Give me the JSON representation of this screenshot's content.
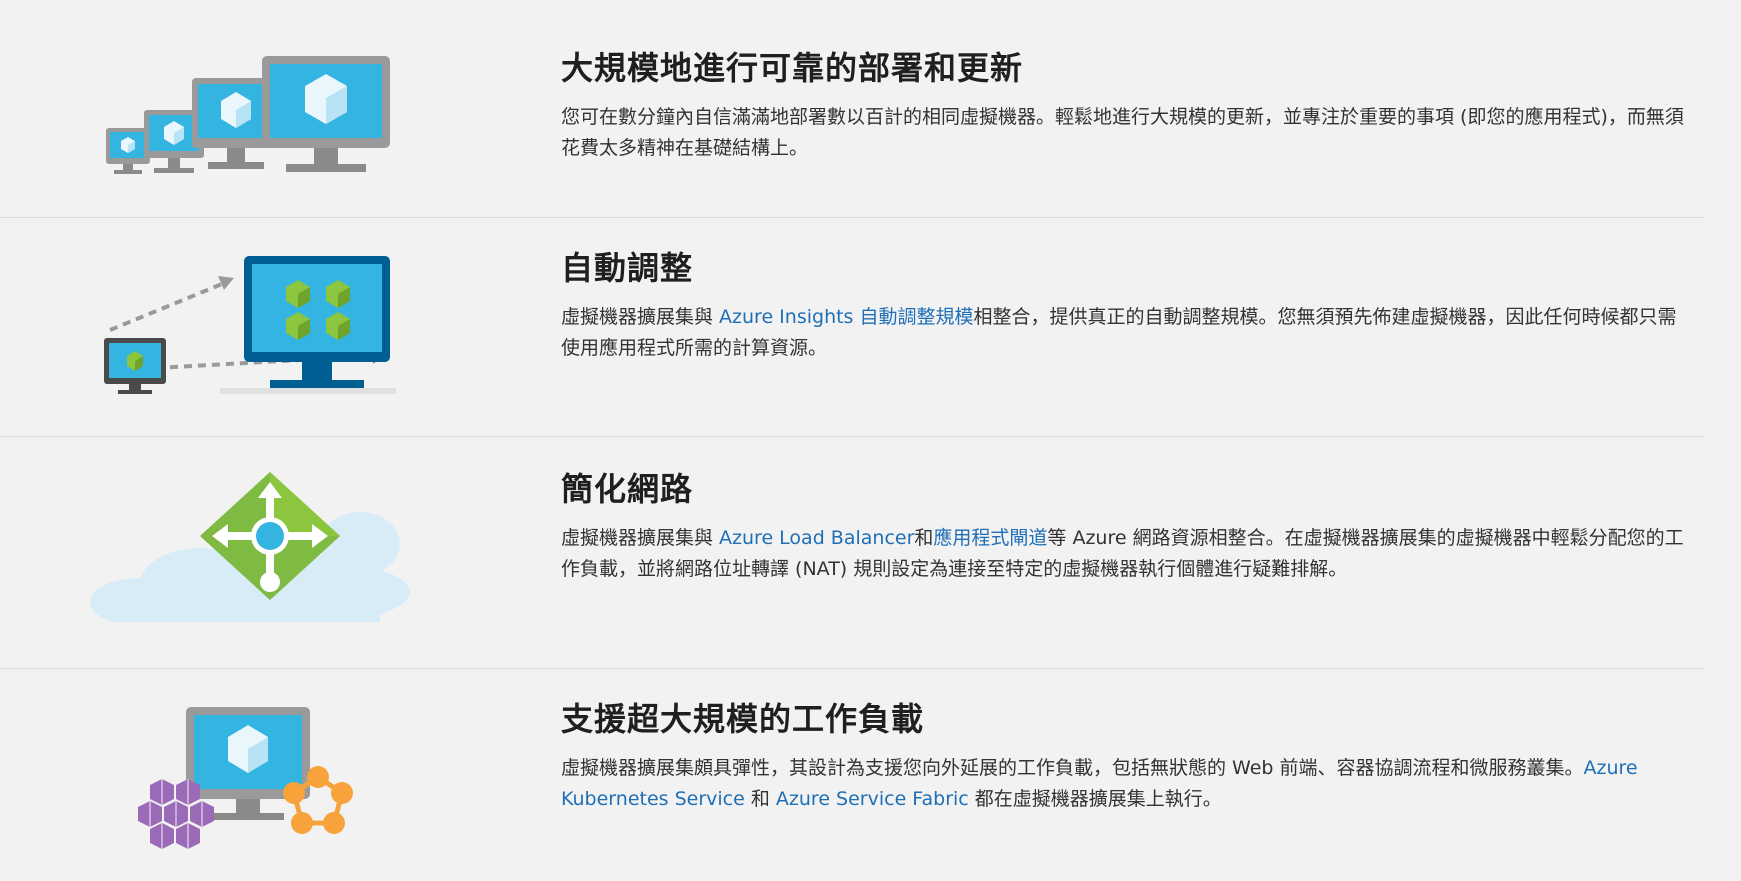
{
  "colors": {
    "link": "#1f6fb6",
    "background": "#f2f2f2",
    "divider": "#d9d9d9",
    "azure_blue": "#34b4e0",
    "monitor_gray": "#9a9a9a",
    "green_cube": "#8cc63f",
    "green_diamond": "#7fba42",
    "purple_hex": "#9b6bb7",
    "orange_node": "#f7a23b",
    "cloud": "#d7ecf7"
  },
  "sections": [
    {
      "title": "大規模地進行可靠的部署和更新",
      "illustration": "scaling-monitors-icon",
      "desc_before": "您可在數分鐘內自信滿滿地部署數以百計的相同虛擬機器。輕鬆地進行大規模的更新，並專注於重要的事項 (即您的應用程式)，而無須花費太多精神在基礎結構上。"
    },
    {
      "title": "自動調整",
      "illustration": "autoscale-monitor-icon",
      "desc_before": "虛擬機器擴展集與 ",
      "link1": "Azure Insights 自動調整規模",
      "desc_after": "相整合，提供真正的自動調整規模。您無須預先佈建虛擬機器，因此任何時候都只需使用應用程式所需的計算資源。"
    },
    {
      "title": "簡化網路",
      "illustration": "load-balancer-cloud-icon",
      "desc_before": "虛擬機器擴展集與 ",
      "link1": "Azure Load Balancer",
      "desc_mid": "和",
      "link2": "應用程式閘道",
      "desc_after": "等 Azure 網路資源相整合。在虛擬機器擴展集的虛擬機器中輕鬆分配您的工作負載，並將網路位址轉譯 (NAT) 規則設定為連接至特定的虛擬機器執行個體進行疑難排解。"
    },
    {
      "title": "支援超大規模的工作負載",
      "illustration": "containers-microservices-icon",
      "desc_before": "虛擬機器擴展集頗具彈性，其設計為支援您向外延展的工作負載，包括無狀態的 Web 前端、容器協調流程和微服務叢集。",
      "link1": "Azure Kubernetes Service",
      "desc_mid": " 和 ",
      "link2": "Azure Service Fabric",
      "desc_after": " 都在虛擬機器擴展集上執行。"
    }
  ]
}
